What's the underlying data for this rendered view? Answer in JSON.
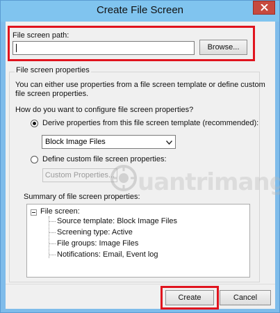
{
  "window": {
    "title": "Create File Screen"
  },
  "path": {
    "label": "File screen path:",
    "value": "",
    "browse_label": "Browse..."
  },
  "properties": {
    "group_label": "File screen properties",
    "description_line1": "You can either use properties from a file screen template or define custom",
    "description_line2": "file screen properties.",
    "question": "How do you want to configure file screen properties?",
    "derive_option_label": "Derive properties from this file screen template (recommended):",
    "derive_selected": true,
    "template_selected": "Block Image Files",
    "custom_option_label": "Define custom file screen properties:",
    "custom_button_label": "Custom Properties..."
  },
  "summary": {
    "label": "Summary of file screen properties:",
    "root": "File screen:",
    "items": [
      "Source template: Block Image Files",
      "Screening type: Active",
      "File groups: Image Files",
      "Notifications: Email, Event log"
    ]
  },
  "footer": {
    "create_label": "Create",
    "cancel_label": "Cancel"
  },
  "watermark": {
    "text": "uantrimang"
  },
  "colors": {
    "highlight_box": "#e0141e",
    "title_bar": "#80c4ef",
    "close_button": "#c74a3f"
  },
  "icons": {
    "close": "close-icon",
    "dropdown": "chevron-down-icon",
    "tree_expander": "collapse-icon"
  }
}
